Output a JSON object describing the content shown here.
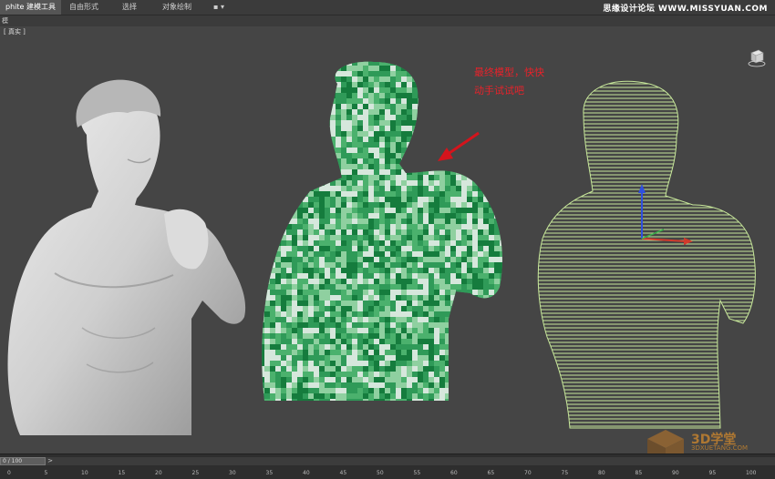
{
  "ribbon": {
    "tabs": [
      {
        "label": "phite 建模工具"
      },
      {
        "label": "自由形式"
      },
      {
        "label": "选择"
      },
      {
        "label": "对象绘制"
      },
      {
        "label": "▪ ▾"
      }
    ],
    "site_watermark": "思缘设计论坛  WWW.MISSYUAN.COM"
  },
  "subbar": {
    "left_label": "模"
  },
  "viewport": {
    "label": "[ 真实 ]",
    "annotation_line1": "最终模型，快快",
    "annotation_line2": "动手试试吧",
    "arrow_color": "#d4141c",
    "annotation_color": "#e8222a",
    "voxel_colors": [
      "#2f9a58",
      "#157c3d",
      "#8fd0a0",
      "#d6e7dc",
      "#4bb16d"
    ],
    "contour_color": "#c7e79a",
    "logo_text": "3D学堂",
    "logo_subtext": "3DXUETANG.COM"
  },
  "timeline": {
    "frame_readout": "0 / 100",
    "next_arrow": ">",
    "ticks": [
      "0",
      "5",
      "10",
      "15",
      "20",
      "25",
      "30",
      "35",
      "40",
      "45",
      "50",
      "55",
      "60",
      "65",
      "70",
      "75",
      "80",
      "85",
      "90",
      "95",
      "100"
    ]
  }
}
